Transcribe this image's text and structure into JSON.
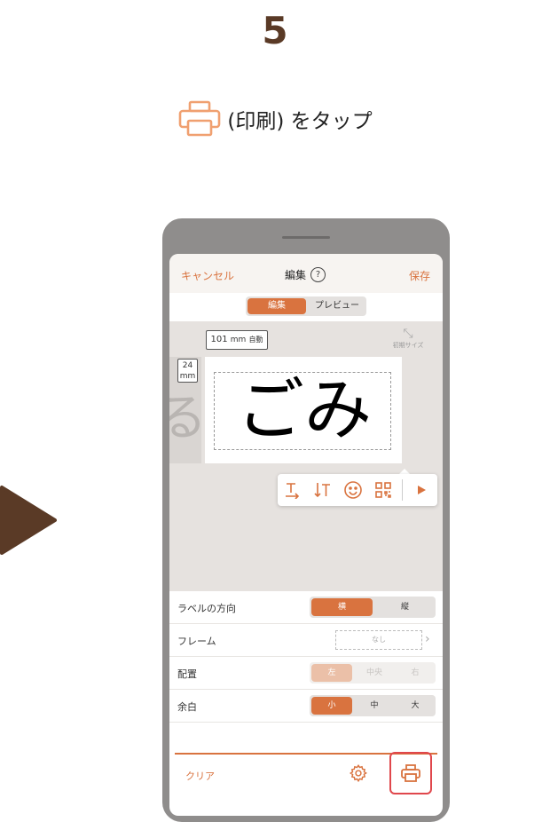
{
  "step": {
    "number": "5"
  },
  "instruction": {
    "icon": "printer-icon",
    "text": "(印刷) をタップ"
  },
  "colors": {
    "accent": "#d9733f",
    "highlight": "#e0474c",
    "arrow": "#5a3a26"
  },
  "nav": {
    "cancel": "キャンセル",
    "title": "編集",
    "help": "?",
    "save": "保存"
  },
  "mode_tabs": {
    "edit": "編集",
    "preview": "プレビュー",
    "selected": "edit"
  },
  "canvas": {
    "width_value": "101",
    "width_unit": "mm",
    "width_mode": "自動",
    "height_value": "24",
    "height_unit": "mm",
    "initial_size_label": "初期サイズ",
    "label_text": "ごみ",
    "previous_label_char": "る"
  },
  "toolbar": {
    "icons": [
      "text-horizontal-icon",
      "text-vertical-icon",
      "emoji-icon",
      "qr-code-icon",
      "play-icon"
    ]
  },
  "settings": {
    "orientation": {
      "label": "ラベルの方向",
      "options": [
        "横",
        "縦"
      ],
      "selected": "横"
    },
    "frame": {
      "label": "フレーム",
      "value": "なし"
    },
    "alignment": {
      "label": "配置",
      "options": [
        "左",
        "中央",
        "右"
      ],
      "selected": "左",
      "disabled": true
    },
    "margin": {
      "label": "余白",
      "options": [
        "小",
        "中",
        "大"
      ],
      "selected": "小"
    }
  },
  "bottom_bar": {
    "clear": "クリア",
    "settings_icon": "gear-icon",
    "print_icon": "printer-icon"
  }
}
